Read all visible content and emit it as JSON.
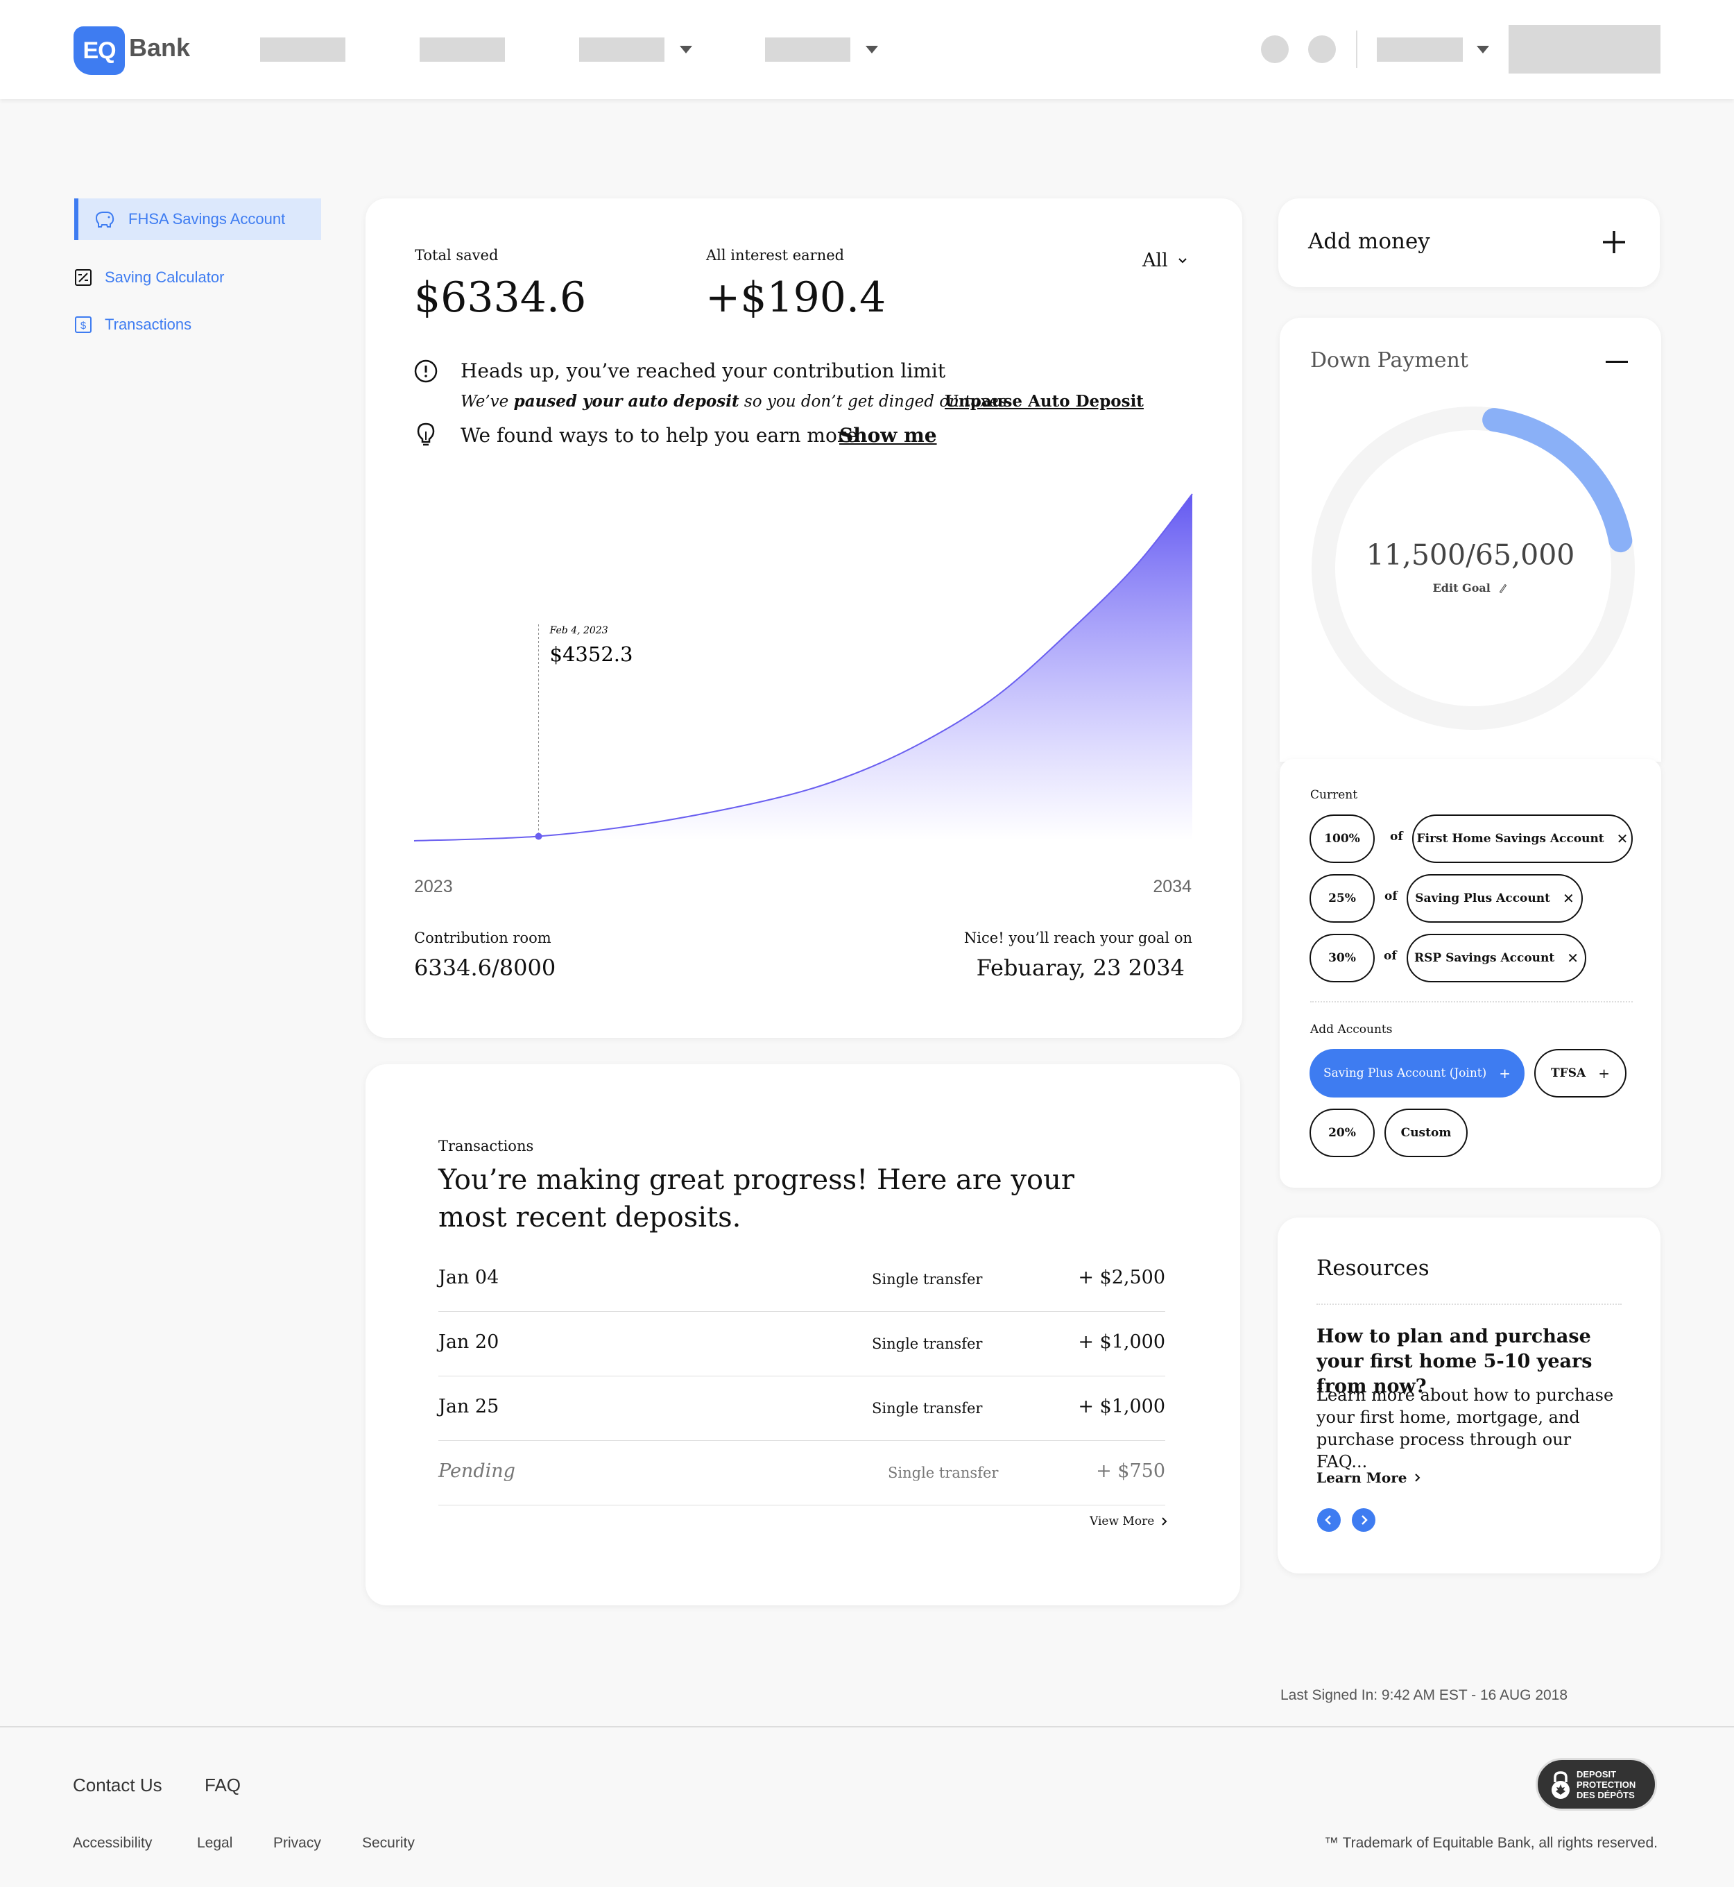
{
  "brand": {
    "logo_mark": "EQ",
    "logo_word": "Bank",
    "accent": "#3e7cf1"
  },
  "sidebar": {
    "items": [
      {
        "label": "FHSA Savings Account",
        "icon": "piggy-bank-icon"
      },
      {
        "label": "Saving Calculator",
        "icon": "calculator-icon"
      },
      {
        "label": "Transactions",
        "icon": "transactions-icon"
      }
    ]
  },
  "summary": {
    "total_saved_label": "Total saved",
    "total_saved_value": "$6334.6",
    "interest_label": "All interest earned",
    "interest_value": "+$190.4",
    "filter_value": "All",
    "alert_title": "Heads up, you’ve reached your contribution limit",
    "alert_pre": "We’ve ",
    "alert_bold": "paused your auto deposit",
    "alert_post": " so you don’t get dinged on taxes",
    "alert_link": "Unpause Auto Deposit",
    "tip_text": "We found ways to to help you earn more",
    "tip_link": "Show me",
    "contribution_label": "Contribution room",
    "contribution_value": "6334.6/8000",
    "goal_label": "Nice! you’ll reach your goal on",
    "goal_value": "Febuaray, 23 2034"
  },
  "chart_data": {
    "type": "area",
    "x_start_label": "2023",
    "x_end_label": "2034",
    "x": [
      0,
      0.16,
      0.3,
      0.45,
      0.55,
      0.65,
      0.75,
      0.85,
      0.93,
      1.0
    ],
    "y": [
      0,
      0.013,
      0.05,
      0.115,
      0.18,
      0.28,
      0.42,
      0.62,
      0.8,
      1.0
    ],
    "tooltip_date": "Feb 4, 2023",
    "tooltip_value": "$4352.3",
    "tooltip_x": 0.16,
    "color": "#6a5ff0"
  },
  "transactions": {
    "label": "Transactions",
    "headline": "You’re making great progress! Here are your most recent deposits.",
    "rows": [
      {
        "date": "Jan 04",
        "type": "Single transfer",
        "amount": "+ $2,500"
      },
      {
        "date": "Jan 20",
        "type": "Single transfer",
        "amount": "+ $1,000"
      },
      {
        "date": "Jan 25",
        "type": "Single transfer",
        "amount": "+ $1,000"
      },
      {
        "date": "Pending",
        "type": "Single transfer",
        "amount": "+ $750"
      }
    ],
    "view_more": "View More"
  },
  "add_money": {
    "label": "Add money"
  },
  "goal": {
    "title": "Down Payment",
    "current": 11500,
    "target": 65000,
    "progress_text": "11,500/65,000",
    "edit_label": "Edit Goal",
    "ring_color": "#8ab0f7"
  },
  "allocations": {
    "current_label": "Current",
    "of_label": "of",
    "rows": [
      {
        "percent": "100%",
        "account": "First Home Savings Account"
      },
      {
        "percent": "25%",
        "account": "Saving Plus Account"
      },
      {
        "percent": "30%",
        "account": "RSP Savings Account"
      }
    ],
    "add_label": "Add Accounts",
    "add_options": [
      {
        "label": "Saving Plus Account (Joint)"
      },
      {
        "label": "TFSA"
      },
      {
        "label": "20%"
      },
      {
        "label": "Custom"
      }
    ]
  },
  "resources": {
    "title": "Resources",
    "article_title": "How to plan and purchase your first home 5-10 years from now?",
    "article_body": "Learn more about how to purchase your first home, mortgage, and purchase process through our FAQ...",
    "learn_more": "Learn More"
  },
  "last_signed_in": "Last Signed In: 9:42 AM EST - 16 AUG 2018",
  "footer": {
    "contact": "Contact Us",
    "faq": "FAQ",
    "links": [
      "Accessibility",
      "Legal",
      "Privacy",
      "Security"
    ],
    "badge_lines": [
      "DEPOSIT",
      "PROTECTION",
      "DES DÉPÔTS"
    ],
    "trademark": "™ Trademark of Equitable Bank, all rights reserved."
  }
}
